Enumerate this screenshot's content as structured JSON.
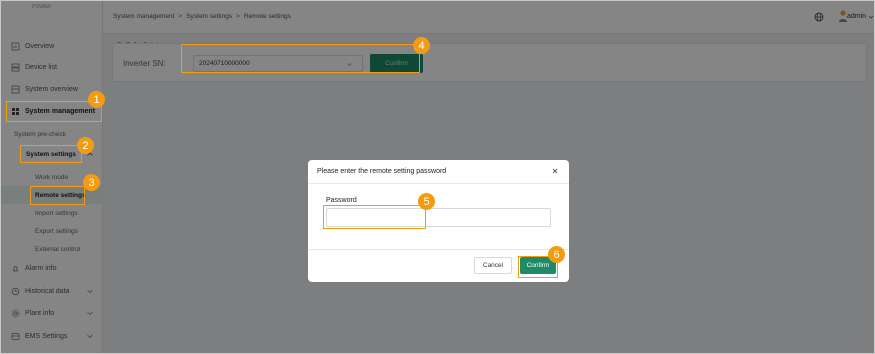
{
  "logo": {
    "text_main": "SOLA",
    "text_x": "X",
    "text_sub": "POWER"
  },
  "header": {
    "breadcrumb": [
      "System management",
      ">",
      "System settings",
      ">",
      "Remote settings"
    ],
    "user": "admin"
  },
  "sidebar": {
    "items": [
      {
        "label": "Overview",
        "icon": "overview-icon"
      },
      {
        "label": "Device list",
        "icon": "device-list-icon"
      },
      {
        "label": "System overview",
        "icon": "system-overview-icon"
      },
      {
        "label": "System management",
        "icon": "system-management-icon"
      },
      {
        "label": "System pre-check"
      },
      {
        "label": "System settings"
      },
      {
        "label": "Work mode"
      },
      {
        "label": "Remote settings"
      },
      {
        "label": "Import settings"
      },
      {
        "label": "Export settings"
      },
      {
        "label": "External control"
      },
      {
        "label": "Alarm info",
        "icon": "alarm-icon"
      },
      {
        "label": "Historical data",
        "icon": "history-icon"
      },
      {
        "label": "Plant info",
        "icon": "plant-info-icon"
      },
      {
        "label": "EMS Settings",
        "icon": "ems-settings-icon"
      }
    ]
  },
  "filter": {
    "sn_label": "Inverter SN:",
    "sn_value": "20240710000000",
    "confirm_label": "Confirm"
  },
  "modal": {
    "title": "Please enter the remote setting password",
    "password_label": "Password",
    "password_value": "",
    "cancel_label": "Cancel",
    "confirm_label": "Confirm"
  },
  "callouts": [
    "1",
    "2",
    "3",
    "4",
    "5",
    "6"
  ],
  "colors": {
    "accent": "#1e8a68",
    "callout": "#f39c12"
  }
}
